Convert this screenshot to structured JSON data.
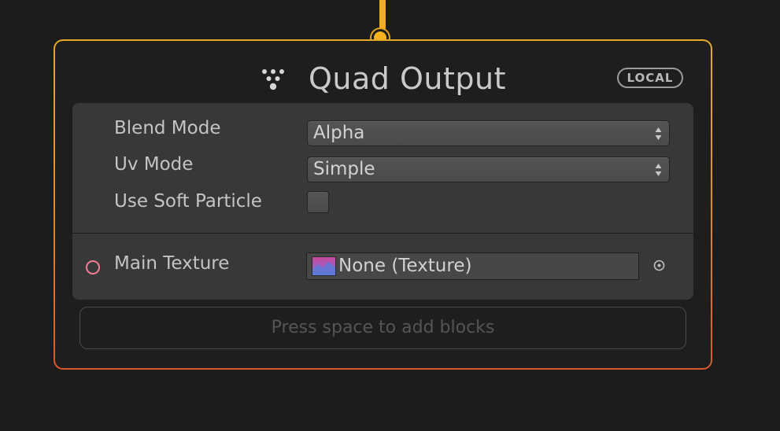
{
  "node": {
    "title": "Quad Output",
    "space_badge": "LOCAL",
    "settings": {
      "blend_mode": {
        "label": "Blend Mode",
        "value": "Alpha"
      },
      "uv_mode": {
        "label": "Uv Mode",
        "value": "Simple"
      },
      "use_soft_particle": {
        "label": "Use Soft Particle",
        "checked": false
      }
    },
    "inputs": {
      "main_texture": {
        "label": "Main Texture",
        "value": "None (Texture)"
      }
    },
    "add_blocks_hint": "Press space to add blocks"
  },
  "colors": {
    "flow_port": "#f4b21e",
    "border_top": "#e7a72a",
    "border_bottom": "#d7582c",
    "texture_port": "#f07f93",
    "panel_bg": "#383838",
    "node_bg": "#1e1e1e"
  },
  "icons": {
    "title": "vfx-output-icon",
    "dropdown": "updown-arrows-icon",
    "picker": "object-picker-icon",
    "thumbnail": "texture-thumbnail-icon"
  }
}
